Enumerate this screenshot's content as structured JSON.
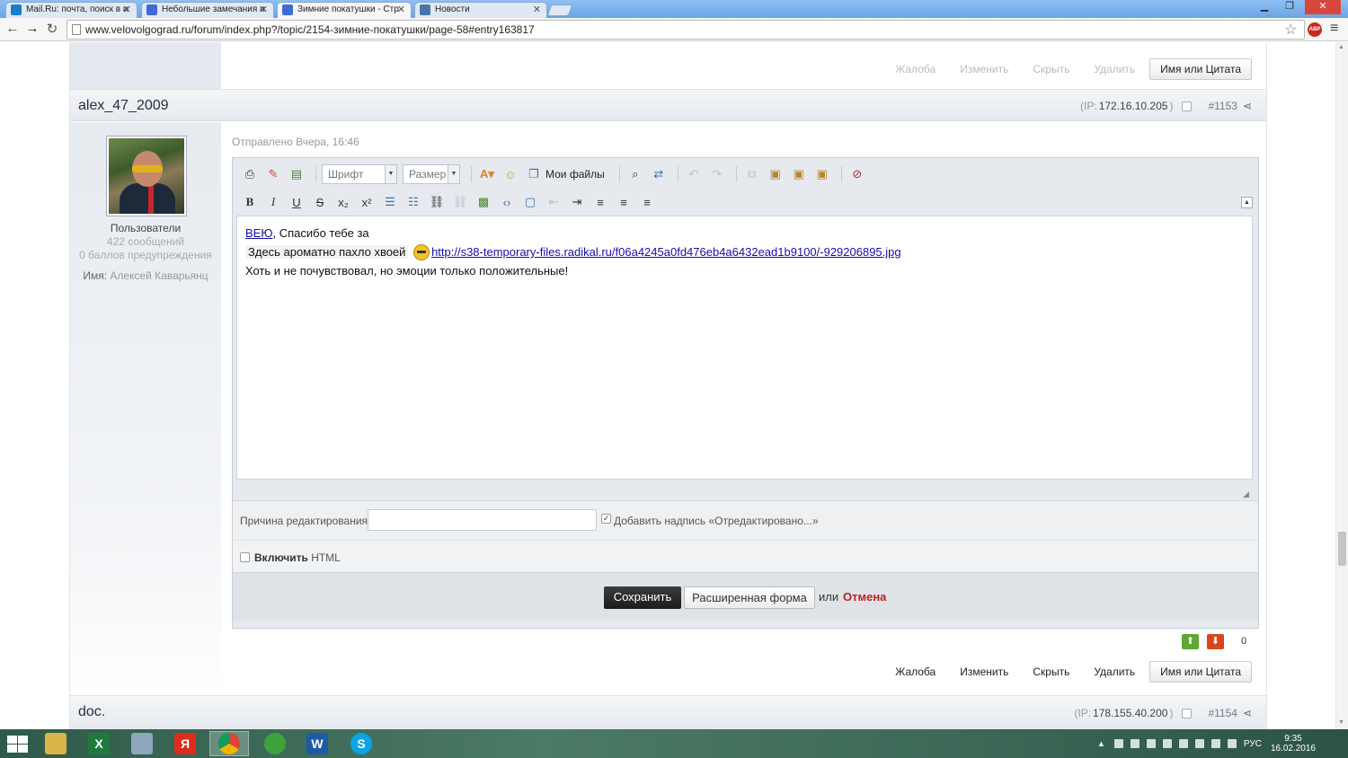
{
  "browser": {
    "tabs": [
      {
        "title": "Mail.Ru: почта, поиск в и",
        "active": false,
        "icon_color": "#1c7ccf"
      },
      {
        "title": "Небольшие замечания и",
        "active": false,
        "icon_color": "#3f6ad8"
      },
      {
        "title": "Зимние покатушки - Стр",
        "active": true,
        "icon_color": "#3f6ad8"
      },
      {
        "title": "Новости",
        "active": false,
        "icon_color": "#4a76a8"
      }
    ],
    "url": "www.velovolgograd.ru/forum/index.php?/topic/2154-зимние-покатушки/page-58#entry163817",
    "abp_label": "ABP"
  },
  "post_actions": {
    "report": "Жалоба",
    "edit": "Изменить",
    "hide": "Скрыть",
    "delete": "Удалить",
    "quote": "Имя или Цитата"
  },
  "post": {
    "author": "alex_47_2009",
    "ip_prefix": "(IP:",
    "ip": "172.16.10.205",
    "ip_suffix": ")",
    "number": "#1153",
    "posted": "Отправлено Вчера, 16:46",
    "group": "Пользователи",
    "posts_count": "422 сообщений",
    "warn_points": "0 баллов предупреждения",
    "name_label": "Имя:",
    "name_value": "Алексей Каварьянц"
  },
  "editor": {
    "font_combo": "Шрифт",
    "size_combo": "Размер",
    "my_files": "Мои файлы",
    "content": {
      "link1": "ВЕЮ",
      "line1_rest": ", Спасибо тебе за",
      "line2_text": "Здесь ароматно пахло хвоей",
      "line2_link": "http://s38-temporary-files.radikal.ru/f06a4245a0fd476eb4a6432ead1b9100/-929206895.jpg",
      "line3": "Хоть и не почувствовал, но эмоции только положительные!"
    },
    "reason_label": "Причина редактирования:",
    "reason_value": "",
    "add_note_label": "Добавить надпись «Отредактировано...»",
    "add_note_checked": true,
    "html_label_bold": "Включить",
    "html_label_rest": "HTML",
    "save_label": "Сохранить",
    "full_form_label": "Расширенная форма",
    "or_label": "или",
    "cancel_label": "Отмена"
  },
  "reputation": {
    "value": "0",
    "up_color": "#5fa831",
    "down_color": "#d8461f"
  },
  "next_post": {
    "author": "doc.",
    "ip_prefix": "(IP:",
    "ip": "178.155.40.200",
    "ip_suffix": ")",
    "number": "#1154"
  },
  "taskbar": {
    "apps": [
      {
        "name": "explorer",
        "label": "",
        "color": "#d9b54a"
      },
      {
        "name": "excel",
        "label": "X",
        "color": "#1f7a3c"
      },
      {
        "name": "calculator",
        "label": "",
        "color": "#8fa6bf"
      },
      {
        "name": "yandex",
        "label": "Я",
        "color": "#e12a1f"
      },
      {
        "name": "chrome",
        "label": "",
        "color": "#ffffff"
      },
      {
        "name": "download",
        "label": "",
        "color": "#3da23a"
      },
      {
        "name": "word",
        "label": "W",
        "color": "#1d5aa8"
      },
      {
        "name": "skype",
        "label": "S",
        "color": "#0aa3e3"
      }
    ],
    "lang": "РУС",
    "time": "9:35",
    "date": "16.02.2016"
  }
}
